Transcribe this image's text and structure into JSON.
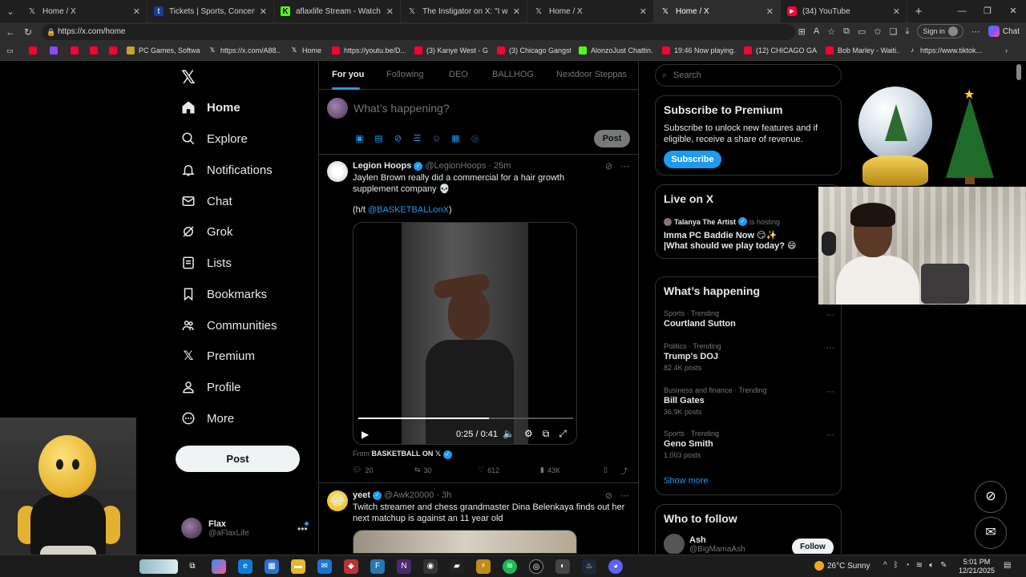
{
  "browser": {
    "tabs": [
      {
        "title": "Home / X",
        "icon": "x-icon",
        "active": false
      },
      {
        "title": "Tickets | Sports, Concerts, Festivals",
        "icon": "ticket-icon",
        "active": false
      },
      {
        "title": "aflaxlife Stream - Watch Live on Kick",
        "icon": "kick-icon",
        "active": false
      },
      {
        "title": "The Instigator on X: \"I want bro in",
        "icon": "x-icon",
        "active": false
      },
      {
        "title": "Home / X",
        "icon": "x-icon",
        "active": false
      },
      {
        "title": "Home / X",
        "icon": "x-icon",
        "active": true
      },
      {
        "title": "(34) YouTube",
        "icon": "youtube-icon",
        "active": false
      }
    ],
    "url": "https://x.com/home",
    "signin_label": "Sign in",
    "chat_label": "Chat",
    "bookmarks": [
      {
        "label": "PC Games, Softwar...",
        "color": "#c9a227"
      },
      {
        "label": "https://x.com/A88...",
        "color": "#ffffff"
      },
      {
        "label": "Home",
        "color": "#ffffff"
      },
      {
        "label": "https://youtu.be/D...",
        "color": "#ff0033"
      },
      {
        "label": "(3) Kanye West - G...",
        "color": "#ff0033"
      },
      {
        "label": "(3) Chicago Gangst...",
        "color": "#ff0033"
      },
      {
        "label": "AlonzoJust Chattin...",
        "color": "#53fc18"
      },
      {
        "label": "19:46 Now playing...",
        "color": "#ff0033"
      },
      {
        "label": "(12) CHICAGO GA...",
        "color": "#ff0033"
      },
      {
        "label": "Bob Marley - Waiti...",
        "color": "#ff0033"
      },
      {
        "label": "https://www.tiktok....",
        "color": "#ffffff"
      }
    ]
  },
  "nav": {
    "items": [
      {
        "label": "Home",
        "icon": "home-icon"
      },
      {
        "label": "Explore",
        "icon": "search-icon"
      },
      {
        "label": "Notifications",
        "icon": "bell-icon"
      },
      {
        "label": "Chat",
        "icon": "mail-icon"
      },
      {
        "label": "Grok",
        "icon": "grok-icon"
      },
      {
        "label": "Lists",
        "icon": "list-icon"
      },
      {
        "label": "Bookmarks",
        "icon": "bookmark-icon"
      },
      {
        "label": "Communities",
        "icon": "people-icon"
      },
      {
        "label": "Premium",
        "icon": "x-icon"
      },
      {
        "label": "Profile",
        "icon": "person-icon"
      },
      {
        "label": "More",
        "icon": "more-circle-icon"
      }
    ],
    "post_label": "Post",
    "account": {
      "name": "Flax",
      "handle": "@aFlaxLife"
    }
  },
  "timeline": {
    "tabs": [
      "For you",
      "Following",
      "DEO",
      "BALLHOG",
      "Nextdoor Steppas"
    ],
    "compose_placeholder": "What’s happening?",
    "compose_post_label": "Post",
    "tweets": [
      {
        "name": "Legion Hoops",
        "handle": "@LegionHoops",
        "time": "· 25m",
        "text": "Jaylen Brown really did a commercial for a hair growth supplement company 💀",
        "credit_prefix": "(h/t ",
        "credit_link": "@BASKETBALLonX",
        "credit_suffix": ")",
        "video_time": "0:25 / 0:41",
        "video_progress": 0.61,
        "from_prefix": "From",
        "from_source": "BASKETBALL ON 𝕏",
        "replies": "20",
        "reposts": "30",
        "likes": "612",
        "views": "43K"
      },
      {
        "name": "yeet",
        "handle": "@Awk20000",
        "time": "· 3h",
        "text": "Twitch streamer and chess grandmaster Dina Belenkaya finds out her next matchup is against an 11 year old"
      }
    ]
  },
  "sidebar": {
    "search_placeholder": "Search",
    "premium": {
      "title": "Subscribe to Premium",
      "desc": "Subscribe to unlock new features and if eligible, receive a share of revenue.",
      "button": "Subscribe"
    },
    "live": {
      "title": "Live on X",
      "host_name": "Talanya The Artist",
      "host_suffix": "is hosting",
      "stream_title": "Imma PC Baddie Now 😏✨ |What should we play today? 😄"
    },
    "happening": {
      "title": "What’s happening",
      "trends": [
        {
          "category": "Sports · Trending",
          "name": "Courtland Sutton",
          "count": ""
        },
        {
          "category": "Politics · Trending",
          "name": "Trump's DOJ",
          "count": "82.4K posts"
        },
        {
          "category": "Business and finance · Trending",
          "name": "Bill Gates",
          "count": "36.9K posts"
        },
        {
          "category": "Sports · Trending",
          "name": "Geno Smith",
          "count": "1,003 posts"
        }
      ],
      "show_more": "Show more"
    },
    "who_to_follow": {
      "title": "Who to follow",
      "name": "Ash",
      "handle": "@BigMamaAsh",
      "button": "Follow"
    }
  },
  "taskbar": {
    "weather": "26°C  Sunny",
    "time": "5:01 PM",
    "date": "12/21/2025"
  },
  "colors": {
    "accent": "#1d9bf0",
    "background": "#000000",
    "border": "#2f3336",
    "muted": "#71767b"
  }
}
